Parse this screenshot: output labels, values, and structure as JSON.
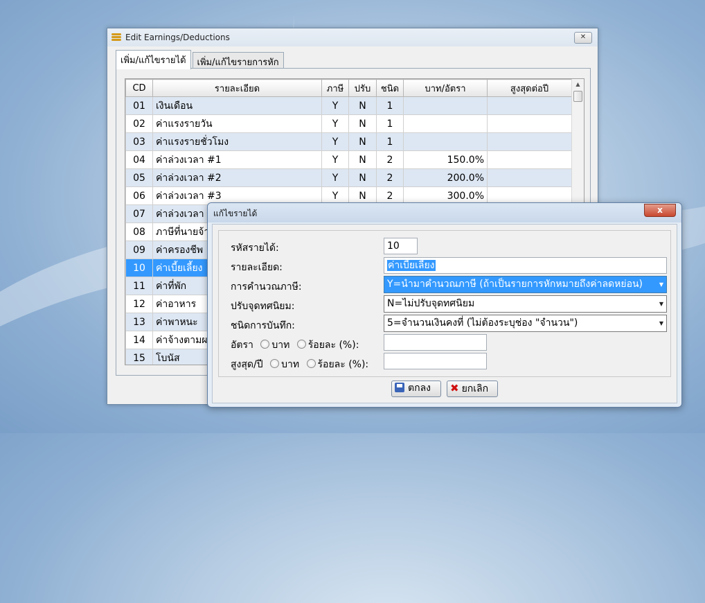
{
  "main_window": {
    "title": "Edit Earnings/Deductions",
    "tabs": [
      "เพิ่ม/แก้ไขรายได้",
      "เพิ่ม/แก้ไขรายการหัก"
    ]
  },
  "grid": {
    "columns": [
      "CD",
      "รายละเอียด",
      "ภาษี",
      "ปรับ",
      "ชนิด",
      "บาท/อัตรา",
      "สูงสุดต่อปี"
    ],
    "rows": [
      [
        "01",
        "เงินเดือน",
        "Y",
        "N",
        "1",
        "",
        ""
      ],
      [
        "02",
        "ค่าแรงรายวัน",
        "Y",
        "N",
        "1",
        "",
        ""
      ],
      [
        "03",
        "ค่าแรงรายชั่วโมง",
        "Y",
        "N",
        "1",
        "",
        ""
      ],
      [
        "04",
        "ค่าล่วงเวลา #1",
        "Y",
        "N",
        "2",
        "150.0%",
        ""
      ],
      [
        "05",
        "ค่าล่วงเวลา #2",
        "Y",
        "N",
        "2",
        "200.0%",
        ""
      ],
      [
        "06",
        "ค่าล่วงเวลา #3",
        "Y",
        "N",
        "2",
        "300.0%",
        ""
      ],
      [
        "07",
        "ค่าล่วงเวลา #",
        "",
        "",
        "",
        "",
        ""
      ],
      [
        "08",
        "ภาษีที่นายจ้า",
        "",
        "",
        "",
        "",
        ""
      ],
      [
        "09",
        "ค่าครองชีพ",
        "",
        "",
        "",
        "",
        ""
      ],
      [
        "10",
        "ค่าเบี้ยเลี้ยง",
        "",
        "",
        "",
        "",
        ""
      ],
      [
        "11",
        "ค่าที่พัก",
        "",
        "",
        "",
        "",
        ""
      ],
      [
        "12",
        "ค่าอาหาร",
        "",
        "",
        "",
        "",
        ""
      ],
      [
        "13",
        "ค่าพาหนะ",
        "",
        "",
        "",
        "",
        ""
      ],
      [
        "14",
        "ค่าจ้างตามผล",
        "",
        "",
        "",
        "",
        ""
      ],
      [
        "15",
        "โบนัส",
        "",
        "",
        "",
        "",
        ""
      ]
    ]
  },
  "dialog": {
    "title": "แก้ไขรายได้",
    "close_label": "x",
    "code_label": "รหัสรายได้:",
    "code_value": "10",
    "desc_label": "รายละเอียด:",
    "desc_value": "ค่าเบี้ยเลี้ยง",
    "tax_label": "การคำนวณภาษี:",
    "tax_value": "Y=นำมาคำนวณภาษี (ถ้าเป็นรายการหักหมายถึงค่าลดหย่อน)",
    "round_label": "ปรับจุดทศนิยม:",
    "round_value": "N=ไม่ปรับจุดทศนิยม",
    "type_label": "ชนิดการบันทึก:",
    "type_value": "5=จำนวนเงินคงที่ (ไม่ต้องระบุช่อง \"จำนวน\")",
    "rate_label": "อัตรา",
    "max_label": "สูงสุด/ปี",
    "opt_baht": "บาท",
    "opt_percent": "ร้อยละ (%):",
    "ok_label": "ตกลง",
    "cancel_label": "ยกเลิก"
  }
}
